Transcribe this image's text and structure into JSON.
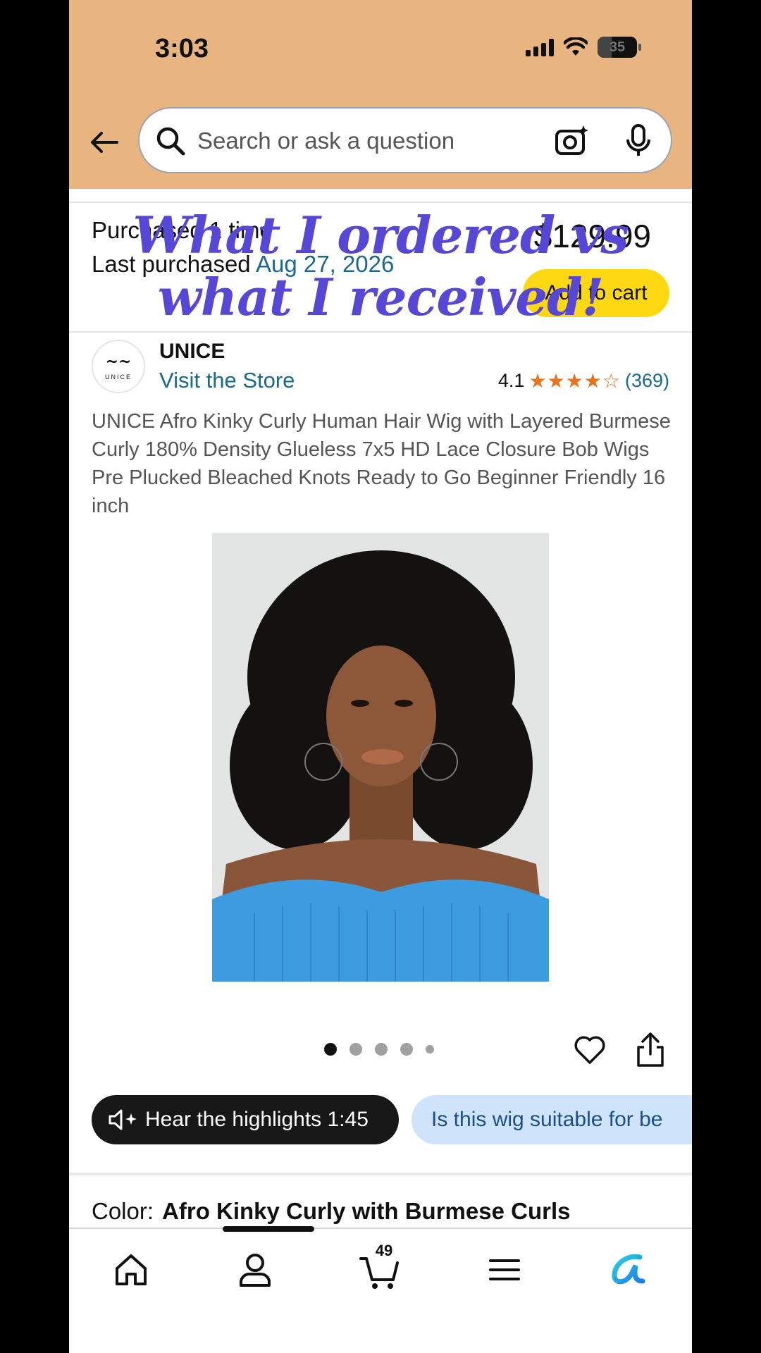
{
  "status_bar": {
    "time": "3:03",
    "battery": "35"
  },
  "search": {
    "placeholder": "Search or ask a question"
  },
  "purchase": {
    "purchased_text": "Purchased 1 time",
    "last_purchased_label": "Last purchased",
    "last_purchased_date": "Aug 27, 2026",
    "price": "$129.99",
    "add_to_cart": "Add to cart"
  },
  "overlay_caption": "What I ordered vs what I received!",
  "brand": {
    "name": "UNICE",
    "logo_word": "UNICE",
    "visit_store": "Visit the Store",
    "rating": "4.1",
    "rating_value": 4.1,
    "rating_count": "(369)"
  },
  "product": {
    "title": "UNICE Afro Kinky Curly Human Hair Wig with Layered Burmese Curly 180% Density Glueless 7x5 HD Lace Closure Bob Wigs Pre Plucked Bleached Knots Ready to Go Beginner Friendly 16 inch",
    "image_count": 5,
    "active_image": 1
  },
  "actions": {
    "hear_highlights": "Hear the highlights 1:45",
    "question_chip": "Is this wig suitable for be"
  },
  "color": {
    "label": "Color:",
    "value": "Afro Kinky Curly with Burmese Curls"
  },
  "bottom_nav": {
    "cart_count": "49",
    "items": [
      "home-icon",
      "account-icon",
      "cart-icon",
      "menu-icon",
      "rufus-icon"
    ]
  },
  "colors": {
    "header_bg": "#E8B580",
    "add_to_cart": "#FFD814",
    "link": "#1a6a8f",
    "star": "#E8731E",
    "overlay_text": "#5647d6"
  }
}
